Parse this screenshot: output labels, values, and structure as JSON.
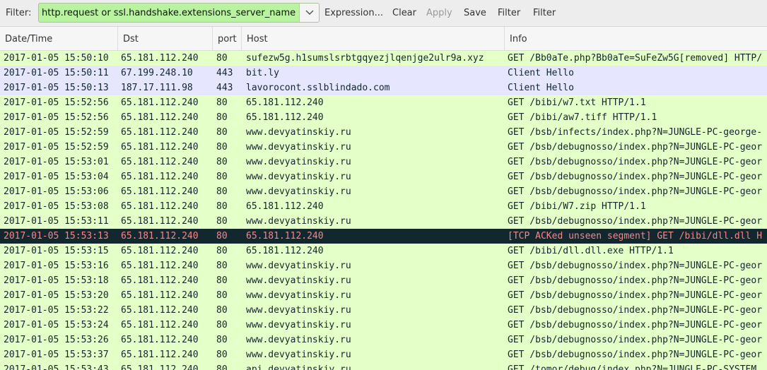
{
  "toolbar": {
    "filter_label": "Filter:",
    "filter_value": "http.request or ssl.handshake.extensions_server_name",
    "expression_label": "Expression...",
    "clear_label": "Clear",
    "apply_label": "Apply",
    "save_label": "Save",
    "filter_button_1": "Filter",
    "filter_button_2": "Filter"
  },
  "columns": {
    "time": "Date/Time",
    "dst": "Dst",
    "port": "port",
    "host": "Host",
    "info": "Info"
  },
  "colors": {
    "http_row": "#e4ffc7",
    "ssl_row": "#e7e6ff",
    "bad_row_bg": "#12272e",
    "bad_row_fg": "#f78787",
    "filter_ok": "#b9f3a0"
  },
  "rows": [
    {
      "type": "http",
      "time": "2017-01-05 15:50:10",
      "dst": "65.181.112.240",
      "port": "80",
      "host": "sufezw5g.h1sumslsrbtgqyezjlqenjge2ulr9a.xyz",
      "info": "GET /Bb0aTe.php?Bb0aTe=SuFeZw5G[removed] HTTP/"
    },
    {
      "type": "ssl",
      "time": "2017-01-05 15:50:11",
      "dst": "67.199.248.10",
      "port": "443",
      "host": "bit.ly",
      "info": "Client Hello"
    },
    {
      "type": "ssl",
      "time": "2017-01-05 15:50:13",
      "dst": "187.17.111.98",
      "port": "443",
      "host": "lavorocont.sslblindado.com",
      "info": "Client Hello"
    },
    {
      "type": "http",
      "time": "2017-01-05 15:52:56",
      "dst": "65.181.112.240",
      "port": "80",
      "host": "65.181.112.240",
      "info": "GET /bibi/w7.txt HTTP/1.1"
    },
    {
      "type": "http",
      "time": "2017-01-05 15:52:56",
      "dst": "65.181.112.240",
      "port": "80",
      "host": "65.181.112.240",
      "info": "GET /bibi/aw7.tiff HTTP/1.1"
    },
    {
      "type": "http",
      "time": "2017-01-05 15:52:59",
      "dst": "65.181.112.240",
      "port": "80",
      "host": "www.devyatinskiy.ru",
      "info": "GET /bsb/infects/index.php?N=JUNGLE-PC-george-"
    },
    {
      "type": "http",
      "time": "2017-01-05 15:52:59",
      "dst": "65.181.112.240",
      "port": "80",
      "host": "www.devyatinskiy.ru",
      "info": "GET /bsb/debugnosso/index.php?N=JUNGLE-PC-geor"
    },
    {
      "type": "http",
      "time": "2017-01-05 15:53:01",
      "dst": "65.181.112.240",
      "port": "80",
      "host": "www.devyatinskiy.ru",
      "info": "GET /bsb/debugnosso/index.php?N=JUNGLE-PC-geor"
    },
    {
      "type": "http",
      "time": "2017-01-05 15:53:04",
      "dst": "65.181.112.240",
      "port": "80",
      "host": "www.devyatinskiy.ru",
      "info": "GET /bsb/debugnosso/index.php?N=JUNGLE-PC-geor"
    },
    {
      "type": "http",
      "time": "2017-01-05 15:53:06",
      "dst": "65.181.112.240",
      "port": "80",
      "host": "www.devyatinskiy.ru",
      "info": "GET /bsb/debugnosso/index.php?N=JUNGLE-PC-geor"
    },
    {
      "type": "http",
      "time": "2017-01-05 15:53:08",
      "dst": "65.181.112.240",
      "port": "80",
      "host": "65.181.112.240",
      "info": "GET /bibi/W7.zip HTTP/1.1"
    },
    {
      "type": "http",
      "time": "2017-01-05 15:53:11",
      "dst": "65.181.112.240",
      "port": "80",
      "host": "www.devyatinskiy.ru",
      "info": "GET /bsb/debugnosso/index.php?N=JUNGLE-PC-geor"
    },
    {
      "type": "bad",
      "time": "2017-01-05 15:53:13",
      "dst": "65.181.112.240",
      "port": "80",
      "host": "65.181.112.240",
      "info": "[TCP ACKed unseen segment] GET /bibi/dll.dll H"
    },
    {
      "type": "http",
      "time": "2017-01-05 15:53:15",
      "dst": "65.181.112.240",
      "port": "80",
      "host": "65.181.112.240",
      "info": "GET /bibi/dll.dll.exe HTTP/1.1"
    },
    {
      "type": "http",
      "time": "2017-01-05 15:53:16",
      "dst": "65.181.112.240",
      "port": "80",
      "host": "www.devyatinskiy.ru",
      "info": "GET /bsb/debugnosso/index.php?N=JUNGLE-PC-geor"
    },
    {
      "type": "http",
      "time": "2017-01-05 15:53:18",
      "dst": "65.181.112.240",
      "port": "80",
      "host": "www.devyatinskiy.ru",
      "info": "GET /bsb/debugnosso/index.php?N=JUNGLE-PC-geor"
    },
    {
      "type": "http",
      "time": "2017-01-05 15:53:20",
      "dst": "65.181.112.240",
      "port": "80",
      "host": "www.devyatinskiy.ru",
      "info": "GET /bsb/debugnosso/index.php?N=JUNGLE-PC-geor"
    },
    {
      "type": "http",
      "time": "2017-01-05 15:53:22",
      "dst": "65.181.112.240",
      "port": "80",
      "host": "www.devyatinskiy.ru",
      "info": "GET /bsb/debugnosso/index.php?N=JUNGLE-PC-geor"
    },
    {
      "type": "http",
      "time": "2017-01-05 15:53:24",
      "dst": "65.181.112.240",
      "port": "80",
      "host": "www.devyatinskiy.ru",
      "info": "GET /bsb/debugnosso/index.php?N=JUNGLE-PC-geor"
    },
    {
      "type": "http",
      "time": "2017-01-05 15:53:26",
      "dst": "65.181.112.240",
      "port": "80",
      "host": "www.devyatinskiy.ru",
      "info": "GET /bsb/debugnosso/index.php?N=JUNGLE-PC-geor"
    },
    {
      "type": "http",
      "time": "2017-01-05 15:53:37",
      "dst": "65.181.112.240",
      "port": "80",
      "host": "www.devyatinskiy.ru",
      "info": "GET /bsb/debugnosso/index.php?N=JUNGLE-PC-geor"
    },
    {
      "type": "http",
      "time": "2017-01-05 15:53:43",
      "dst": "65.181.112.240",
      "port": "80",
      "host": "api.devyatinskiy.ru",
      "info": "GET /tomor/debug/index.php?N=JUNGLE-PC-SYSTEM"
    }
  ]
}
